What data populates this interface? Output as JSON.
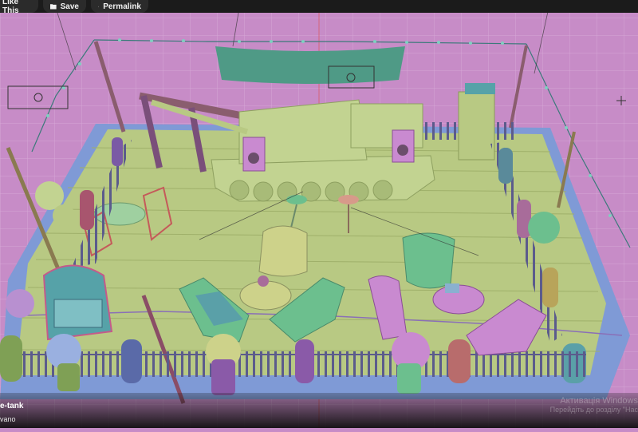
{
  "toolbar": {
    "like_label": "Like This",
    "save_label": "Save",
    "permalink_label": "Permalink"
  },
  "model": {
    "title": "e-tank",
    "author": "vano"
  },
  "watermark": {
    "line1": "Активація Windows",
    "line2": "Перейдіть до розділу \"Нас"
  },
  "colors": {
    "background": "#c78cc7",
    "floor": "#b8c983",
    "plank": "#c6d98f",
    "tank": "#c2d391",
    "jukebox": "#56a2a8",
    "chair_green": "#6cbf8e",
    "pink": "#c98ad0"
  }
}
